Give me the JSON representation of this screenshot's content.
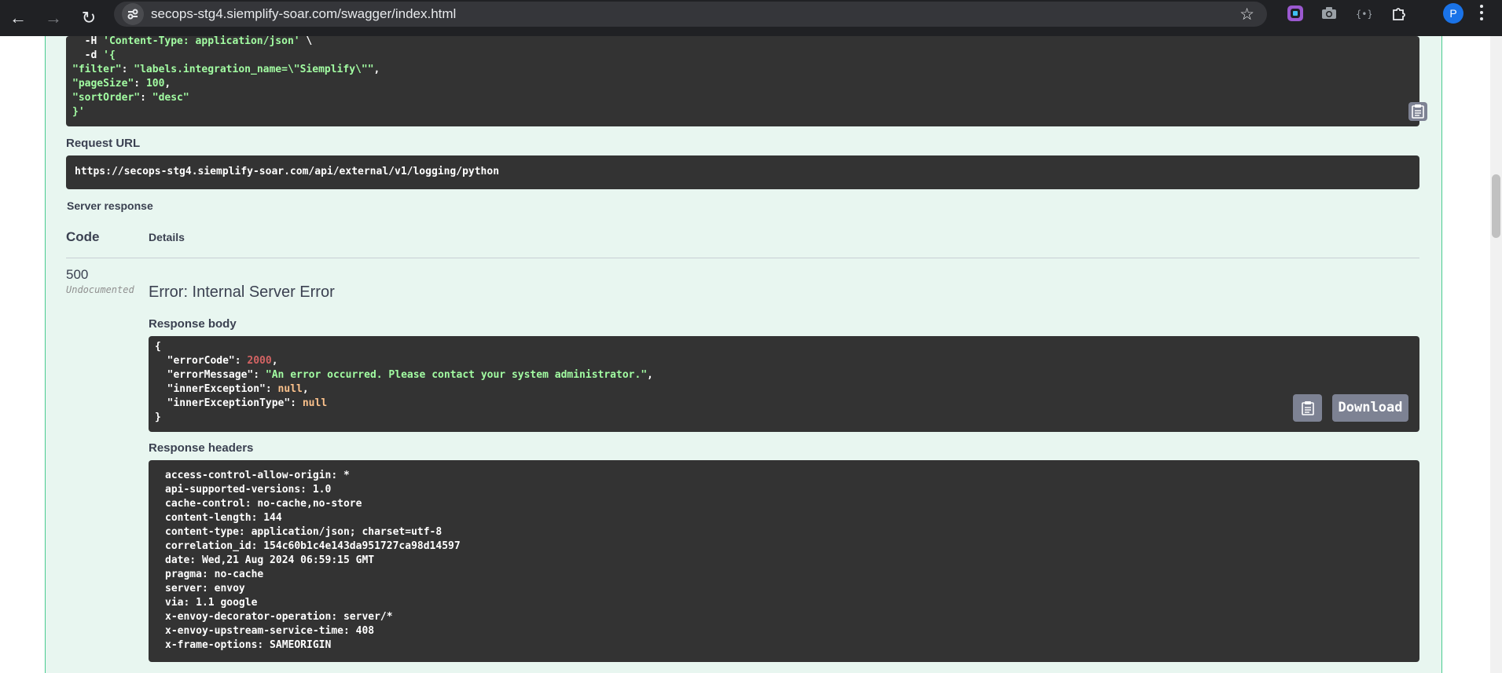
{
  "browser": {
    "url": "secops-stg4.siemplify-soar.com/swagger/index.html",
    "profile_initial": "P"
  },
  "curl": {
    "lines": [
      {
        "indent": "  ",
        "flag": "-H",
        "value": "'Content-Type: application/json'",
        "suffix": " \\"
      },
      {
        "indent": "  ",
        "flag": "-d",
        "value": "'{",
        "suffix": ""
      },
      {
        "key": "\"filter\"",
        "value": "\"labels.integration_name=\\\"Siemplify\\\"\"",
        "suffix": ","
      },
      {
        "key": "\"pageSize\"",
        "value": "100",
        "suffix": ","
      },
      {
        "key": "\"sortOrder\"",
        "value": "\"desc\"",
        "suffix": ""
      },
      {
        "raw": "}'"
      }
    ]
  },
  "request_url": {
    "label": "Request URL",
    "value": "https://secops-stg4.siemplify-soar.com/api/external/v1/logging/python"
  },
  "server_response": {
    "label": "Server response",
    "col_code": "Code",
    "col_details": "Details",
    "code": "500",
    "code_note": "Undocumented",
    "error_title": "Error: Internal Server Error",
    "body_label": "Response body",
    "download_label": "Download",
    "headers_label": "Response headers"
  },
  "response_body": {
    "errorCode": "2000",
    "errorMessage": "\"An error occurred. Please contact your system administrator.\"",
    "innerException": "null",
    "innerExceptionType": "null"
  },
  "response_headers": [
    "access-control-allow-origin: *",
    "api-supported-versions: 1.0",
    "cache-control: no-cache,no-store",
    "content-length: 144",
    "content-type: application/json; charset=utf-8",
    "correlation_id: 154c60b1c4e143da951727ca98d14597",
    "date: Wed,21 Aug 2024 06:59:15 GMT",
    "pragma: no-cache",
    "server: envoy",
    "via: 1.1 google",
    "x-envoy-decorator-operation: server/*",
    "x-envoy-upstream-service-time: 408",
    "x-frame-options: SAMEORIGIN"
  ],
  "colors": {
    "post_green": "#49cc90",
    "opblock_bg": "#e8f6f0",
    "code_bg": "#333333"
  }
}
